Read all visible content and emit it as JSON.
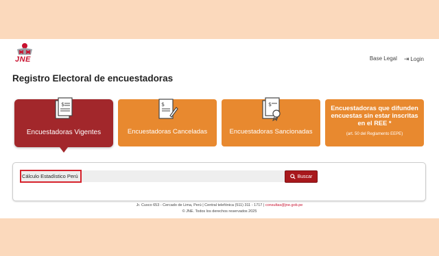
{
  "header": {
    "logo_text": "JNE",
    "nav": {
      "legal_label": "Base Legal",
      "login_label": "Login"
    }
  },
  "page_title": "Registro Electoral de encuestadoras",
  "cards": [
    {
      "label": "Encuestadoras Vigentes"
    },
    {
      "label": "Encuestadoras Canceladas"
    },
    {
      "label": "Encuestadoras Sancionadas"
    },
    {
      "label": "Encuestadoras que difunden encuestas sin estar inscritas en el REE *",
      "sub": "(art. 50 del Reglamento EEPE)"
    }
  ],
  "search": {
    "value": "Cálculo Estadístico Perú",
    "button_label": "Buscar"
  },
  "footer": {
    "line1": "Jr. Cusco 653 - Cercado de Lima, Perú | Central telefónica (511) 311 - 1717 |",
    "email": "consultas@jne.gob.pe",
    "line2": "© JNE. Todos los derechos reservados 2025"
  },
  "colors": {
    "active": "#a2272b",
    "card": "#e8892f",
    "background": "#fbd9bc"
  }
}
